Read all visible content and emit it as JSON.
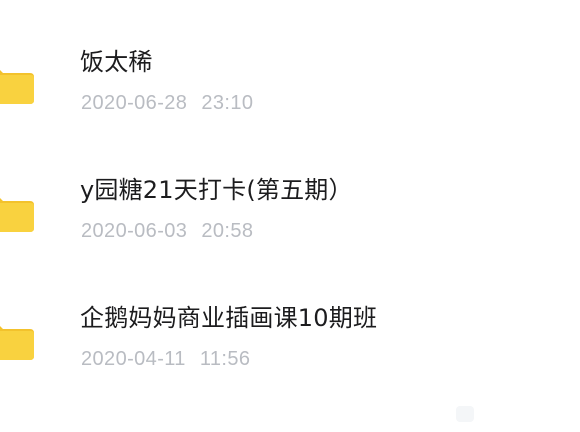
{
  "files": [
    {
      "name": "饭太稀",
      "date": "2020-06-28",
      "time": "23:10",
      "icon": "folder-icon"
    },
    {
      "name": "y园糖21天打卡(第五期）",
      "date": "2020-06-03",
      "time": "20:58",
      "icon": "folder-icon"
    },
    {
      "name": "企鹅妈妈商业插画课10期班",
      "date": "2020-04-11",
      "time": "11:56",
      "icon": "folder-icon"
    }
  ],
  "colors": {
    "folder": "#f9d23f",
    "folder_back": "#f3c22c",
    "name_text": "#1c1c1e",
    "date_text": "#b9bcc2"
  }
}
